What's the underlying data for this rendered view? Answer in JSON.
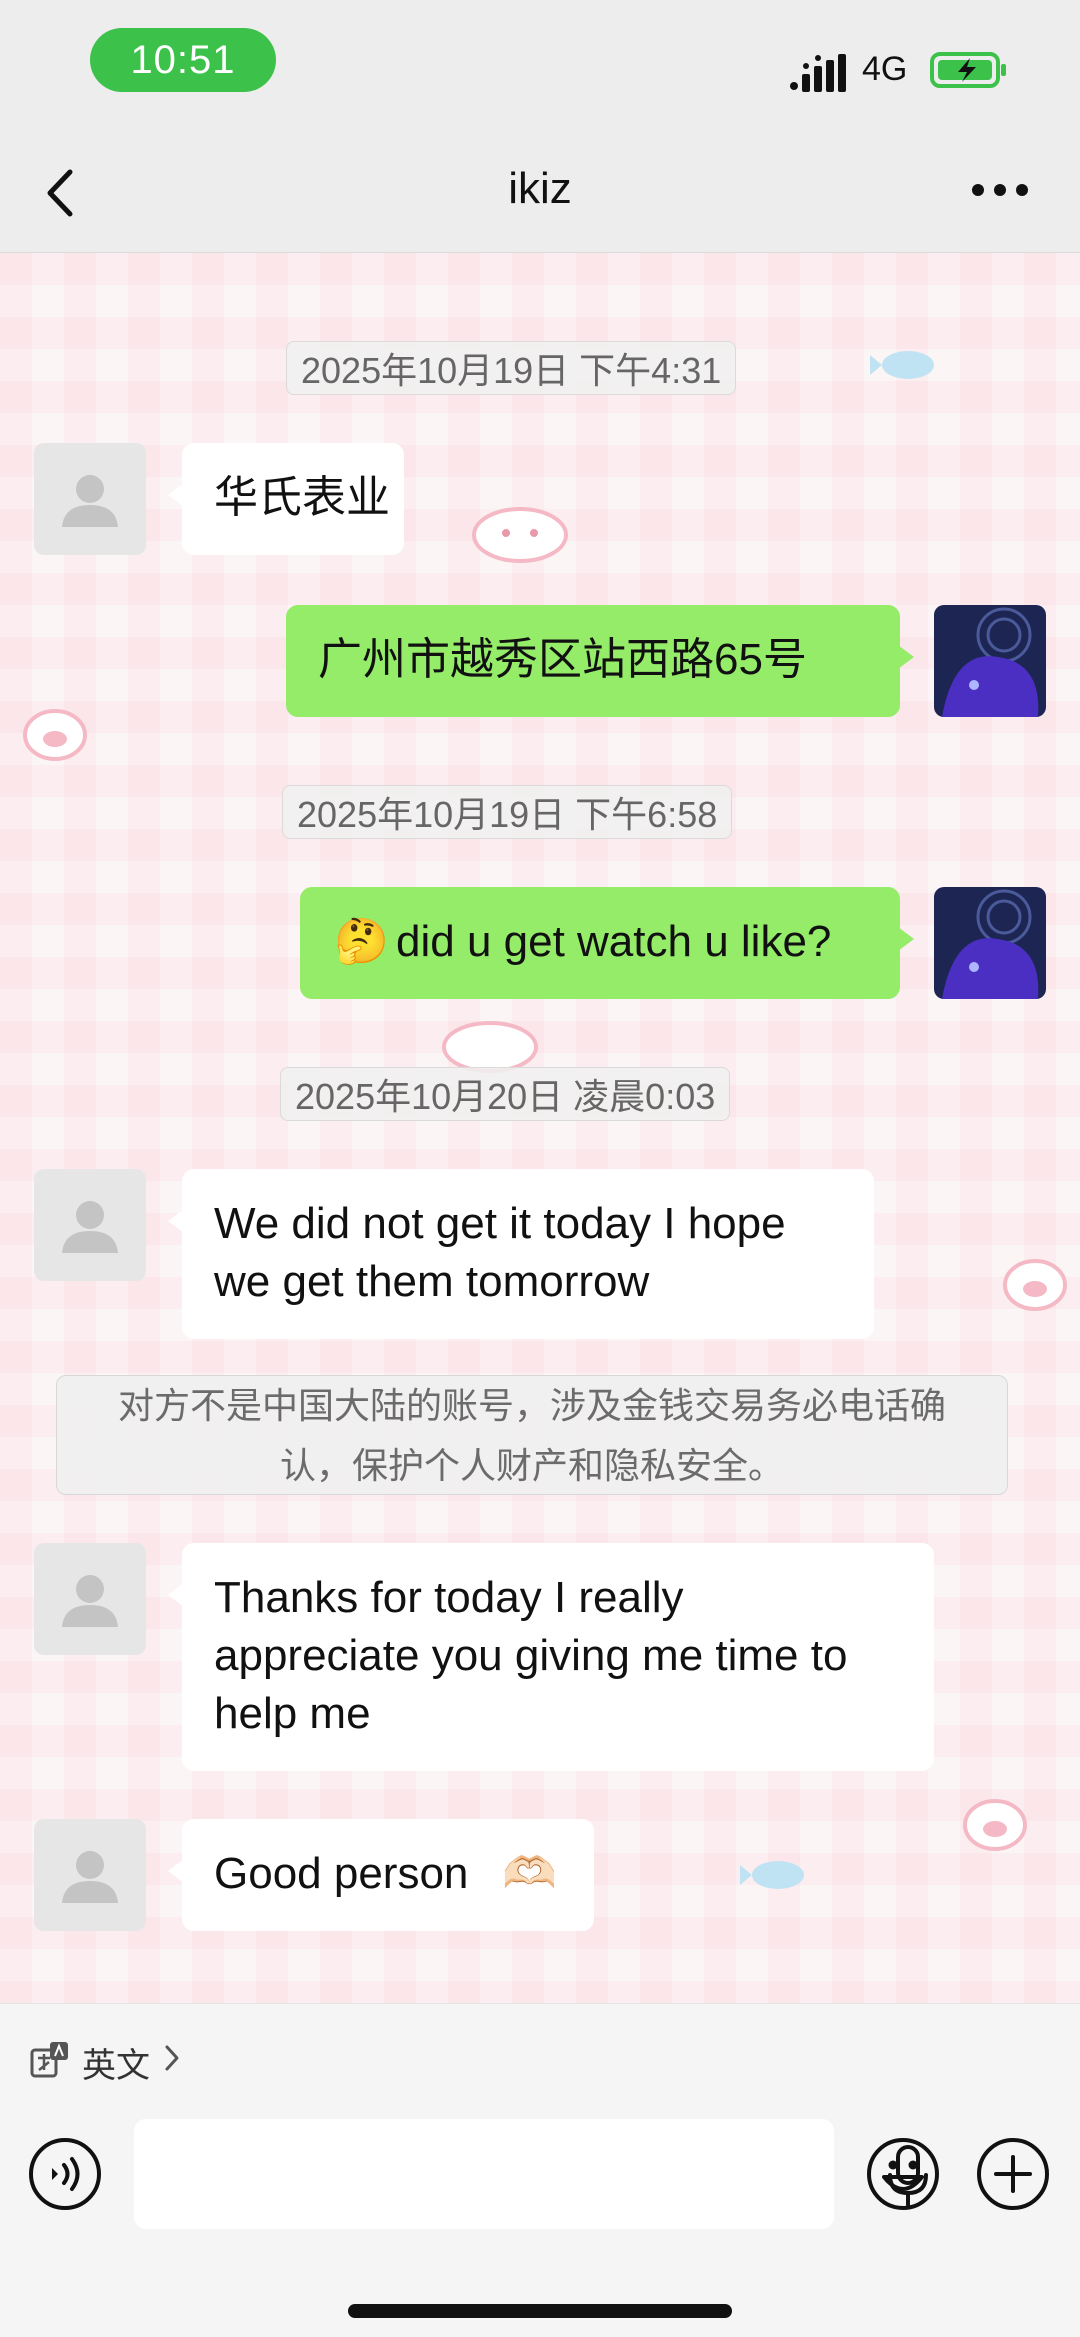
{
  "status_bar": {
    "time": "10:51",
    "network": "4G"
  },
  "navbar": {
    "title": "ikiz"
  },
  "messages": {
    "ts1": "2025年10月19日 下午4:31",
    "m1": "华氏表业",
    "m2": "广州市越秀区站西路65号",
    "ts2": "2025年10月19日 下午6:58",
    "m3_emoji": "🤔",
    "m3": "did u get watch u like?",
    "ts3": "2025年10月20日 凌晨0:03",
    "m4_line1": "We did not get it today I hope",
    "m4_line2": "we get them tomorrow",
    "notice_line1": "对方不是中国大陆的账号，涉及金钱交易务必电话确",
    "notice_line2": "认，保护个人财产和隐私安全。",
    "m5_line1": "Thanks for today I really",
    "m5_line2": "appreciate you giving me time to",
    "m5_line3": "help me",
    "m6": "Good person",
    "m6_emoji": "🫶🏻"
  },
  "translate": {
    "label": "英文"
  },
  "colors": {
    "my_bubble": "#95ec69",
    "their_bubble": "#ffffff",
    "time_pill": "#3cc24a"
  },
  "icons": [
    "chevron-left-icon",
    "more-icon",
    "translate-icon",
    "voice-icon",
    "mic-icon",
    "emoji-icon",
    "plus-icon"
  ]
}
